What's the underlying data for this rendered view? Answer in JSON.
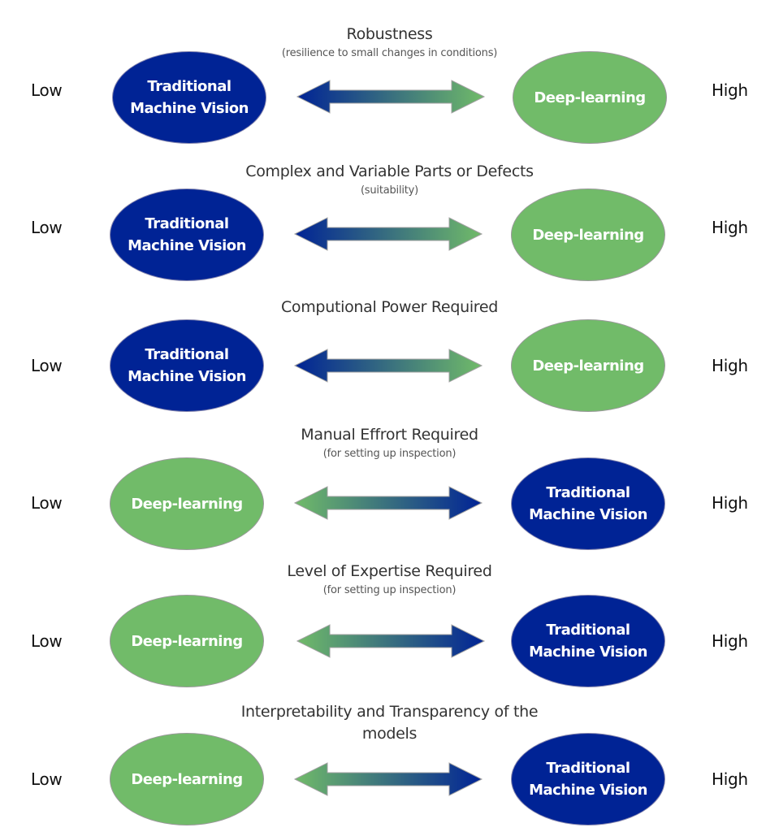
{
  "colors": {
    "traditional": "#002395",
    "deep_learning": "#71bb69",
    "title_text": "#333333",
    "subtitle_text": "#555555"
  },
  "scale_labels": {
    "low": "Low",
    "high": "High"
  },
  "rows": [
    {
      "title": "Robustness",
      "subtitle": "(resilience to small changes in conditions)",
      "low_side": "Traditional\nMachine Vision",
      "high_side": "Deep-learning",
      "arrow_icon": "double-arrow-icon",
      "arrow_gradient": "blue-to-green"
    },
    {
      "title": "Complex and Variable Parts or Defects",
      "subtitle": "(suitability)",
      "low_side": "Traditional\nMachine Vision",
      "high_side": "Deep-learning",
      "arrow_icon": "double-arrow-icon",
      "arrow_gradient": "blue-to-green"
    },
    {
      "title": "Computional Power Required",
      "subtitle": "",
      "low_side": "Traditional\nMachine Vision",
      "high_side": "Deep-learning",
      "arrow_icon": "double-arrow-icon",
      "arrow_gradient": "blue-to-green"
    },
    {
      "title": "Manual Effrort Required",
      "subtitle": "(for setting up inspection)",
      "low_side": "Deep-learning",
      "high_side": "Traditional\nMachine Vision",
      "arrow_icon": "double-arrow-icon",
      "arrow_gradient": "green-to-blue"
    },
    {
      "title": "Level of Expertise Required",
      "subtitle": "(for setting up inspection)",
      "low_side": "Deep-learning",
      "high_side": "Traditional\nMachine Vision",
      "arrow_icon": "double-arrow-icon",
      "arrow_gradient": "green-to-blue"
    },
    {
      "title": "Interpretability and Transparency of the\nmodels",
      "subtitle": "",
      "low_side": "Deep-learning",
      "high_side": "Traditional\nMachine Vision",
      "arrow_icon": "double-arrow-icon",
      "arrow_gradient": "green-to-blue"
    }
  ]
}
